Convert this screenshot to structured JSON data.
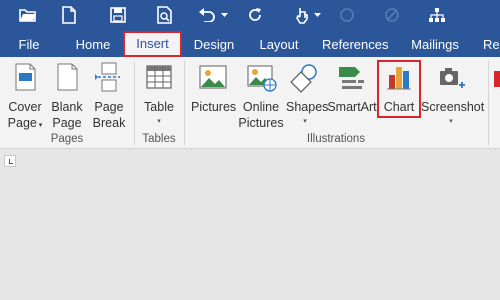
{
  "colors": {
    "accent": "#2b579a",
    "highlight": "#d7262c",
    "ribbon_bg": "#f3f3f3"
  },
  "quick_access": [
    {
      "name": "folder-icon"
    },
    {
      "name": "new-document-icon"
    },
    {
      "name": "save-icon"
    },
    {
      "name": "print-preview-icon"
    },
    {
      "name": "undo-icon"
    },
    {
      "name": "repeat-icon"
    },
    {
      "name": "touch-mode-icon"
    },
    {
      "name": "circle-icon"
    },
    {
      "name": "draw-icon"
    },
    {
      "name": "org-chart-icon"
    }
  ],
  "tabs": [
    {
      "label": "File"
    },
    {
      "label": "Home"
    },
    {
      "label": "Insert",
      "active": true
    },
    {
      "label": "Design"
    },
    {
      "label": "Layout"
    },
    {
      "label": "References"
    },
    {
      "label": "Mailings"
    },
    {
      "label": "Re"
    }
  ],
  "ribbon": {
    "pages_group": {
      "label": "Pages",
      "cover_page": {
        "line1": "Cover",
        "line2": "Page"
      },
      "blank_page": {
        "line1": "Blank",
        "line2": "Page"
      },
      "page_break": {
        "line1": "Page",
        "line2": "Break"
      }
    },
    "tables_group": {
      "label": "Tables",
      "table": "Table"
    },
    "illustrations_group": {
      "label": "Illustrations",
      "pictures": "Pictures",
      "online_pictures": {
        "line1": "Online",
        "line2": "Pictures"
      },
      "shapes": "Shapes",
      "smartart": "SmartArt",
      "chart": "Chart",
      "screenshot": "Screenshot"
    }
  }
}
